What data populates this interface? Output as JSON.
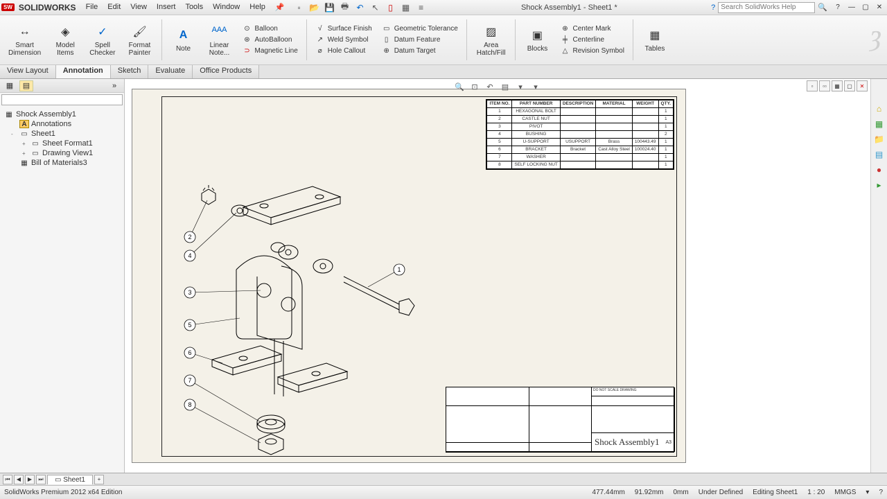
{
  "app": {
    "logo": "SW",
    "name": "SOLIDWORKS",
    "doc_title": "Shock Assembly1 - Sheet1 *"
  },
  "menu": [
    "File",
    "Edit",
    "View",
    "Insert",
    "Tools",
    "Window",
    "Help"
  ],
  "help_search": {
    "placeholder": "Search SolidWorks Help"
  },
  "ribbon": {
    "big": [
      {
        "label": "Smart\nDimension"
      },
      {
        "label": "Model\nItems"
      },
      {
        "label": "Spell\nChecker"
      },
      {
        "label": "Format\nPainter"
      },
      {
        "label": "Note"
      },
      {
        "label": "Linear\nNote..."
      }
    ],
    "col1": [
      "Balloon",
      "AutoBalloon",
      "Magnetic Line"
    ],
    "col2": [
      "Surface Finish",
      "Weld Symbol",
      "Hole Callout"
    ],
    "col3": [
      "Geometric Tolerance",
      "Datum Feature",
      "Datum Target"
    ],
    "big2": [
      {
        "label": "Area\nHatch/Fill"
      },
      {
        "label": "Blocks"
      }
    ],
    "col4": [
      "Center Mark",
      "Centerline",
      "Revision Symbol"
    ],
    "big3": [
      {
        "label": "Tables"
      }
    ]
  },
  "tabs": [
    "View Layout",
    "Annotation",
    "Sketch",
    "Evaluate",
    "Office Products"
  ],
  "active_tab": "Annotation",
  "tree": {
    "root": "Shock Assembly1",
    "items": [
      {
        "label": "Annotations",
        "level": 1,
        "icon": "A",
        "color": "#c80"
      },
      {
        "label": "Sheet1",
        "level": 1,
        "icon": "▭",
        "exp": "-"
      },
      {
        "label": "Sheet Format1",
        "level": 2,
        "icon": "▭",
        "exp": "+"
      },
      {
        "label": "Drawing View1",
        "level": 2,
        "icon": "▭",
        "exp": "+"
      },
      {
        "label": "Bill of Materials3",
        "level": 1,
        "icon": "▦"
      }
    ]
  },
  "bom": {
    "headers": [
      "ITEM NO.",
      "PART NUMBER",
      "DESCRIPTION",
      "MATERIAL",
      "WEIGHT",
      "QTY."
    ],
    "rows": [
      [
        "1",
        "HEXAGONAL BOLT",
        "",
        "",
        "",
        "1"
      ],
      [
        "2",
        "CASTLE NUT",
        "",
        "",
        "",
        "1"
      ],
      [
        "3",
        "PIVOT",
        "",
        "",
        "",
        "1"
      ],
      [
        "4",
        "BUSHING",
        "",
        "",
        "",
        "2"
      ],
      [
        "5",
        "U-SUPPORT",
        "USUPPORT",
        "Brass",
        "100443.49",
        "1"
      ],
      [
        "6",
        "BRACKET",
        "Bracket",
        "Cast Alloy Steel",
        "100024.40",
        "1"
      ],
      [
        "7",
        "WASHER",
        "",
        "",
        "",
        "1"
      ],
      [
        "8",
        "SELF LOCKING NUT",
        "",
        "",
        "",
        "1"
      ]
    ]
  },
  "balloons": [
    "1",
    "2",
    "3",
    "4",
    "5",
    "6",
    "7",
    "8"
  ],
  "titleblock": {
    "drawing_name": "Shock Assembly1",
    "size": "A3",
    "scale_label": "DO NOT SCALE DRAWING"
  },
  "sheet_tabs": [
    "Sheet1"
  ],
  "status": {
    "edition": "SolidWorks Premium 2012 x64 Edition",
    "x": "477.44mm",
    "y": "91.92mm",
    "z": "0mm",
    "state": "Under Defined",
    "context": "Editing Sheet1",
    "scale": "1 : 20",
    "units": "MMGS"
  }
}
